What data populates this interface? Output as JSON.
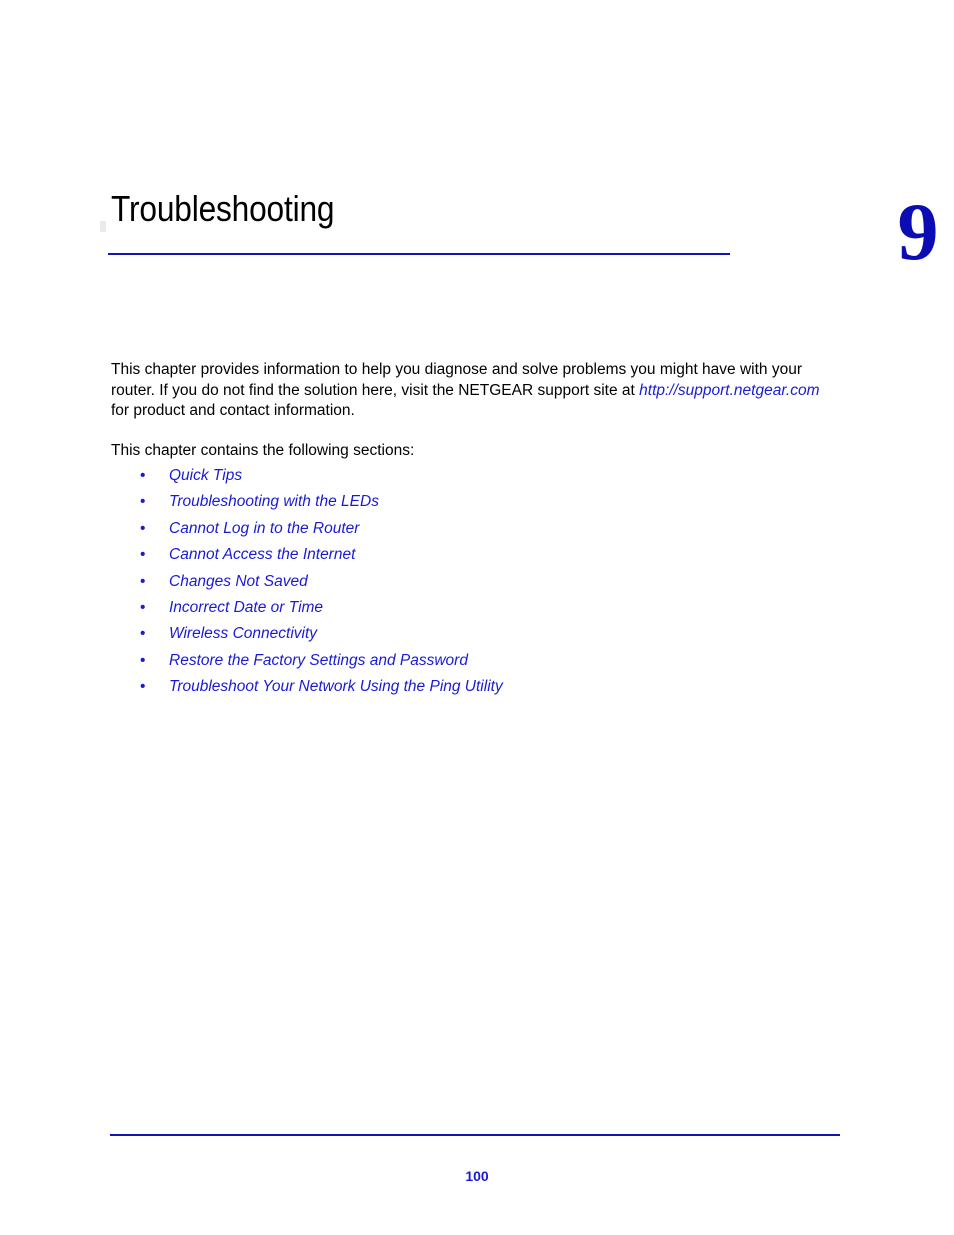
{
  "chapter": {
    "title": "Troubleshooting",
    "number": "9"
  },
  "intro": {
    "line_before_link": "This chapter provides information to help you diagnose and solve problems you might have with your router. If you do not find the solution here, visit the NETGEAR support site at ",
    "link_text": "http://support.netgear.com",
    "line_after_link": " for product and contact information.",
    "sections_lead_in": "This chapter contains the following sections:"
  },
  "bullet_glyph": "•",
  "sections": [
    {
      "label": "Quick Tips"
    },
    {
      "label": "Troubleshooting with the LEDs"
    },
    {
      "label": "Cannot Log in to the Router"
    },
    {
      "label": "Cannot Access the Internet"
    },
    {
      "label": "Changes Not Saved"
    },
    {
      "label": "Incorrect Date or Time"
    },
    {
      "label": "Wireless Connectivity"
    },
    {
      "label": "Restore the Factory Settings and Password"
    },
    {
      "label": "Troubleshoot Your Network Using the Ping Utility"
    }
  ],
  "footer": {
    "page_number": "100"
  },
  "colors": {
    "link_blue": "#1a1ad6",
    "rule_blue": "#1414b4",
    "chapter_number_blue": "#0c0cb4",
    "body_text": "#000000",
    "page_background": "#ffffff"
  }
}
